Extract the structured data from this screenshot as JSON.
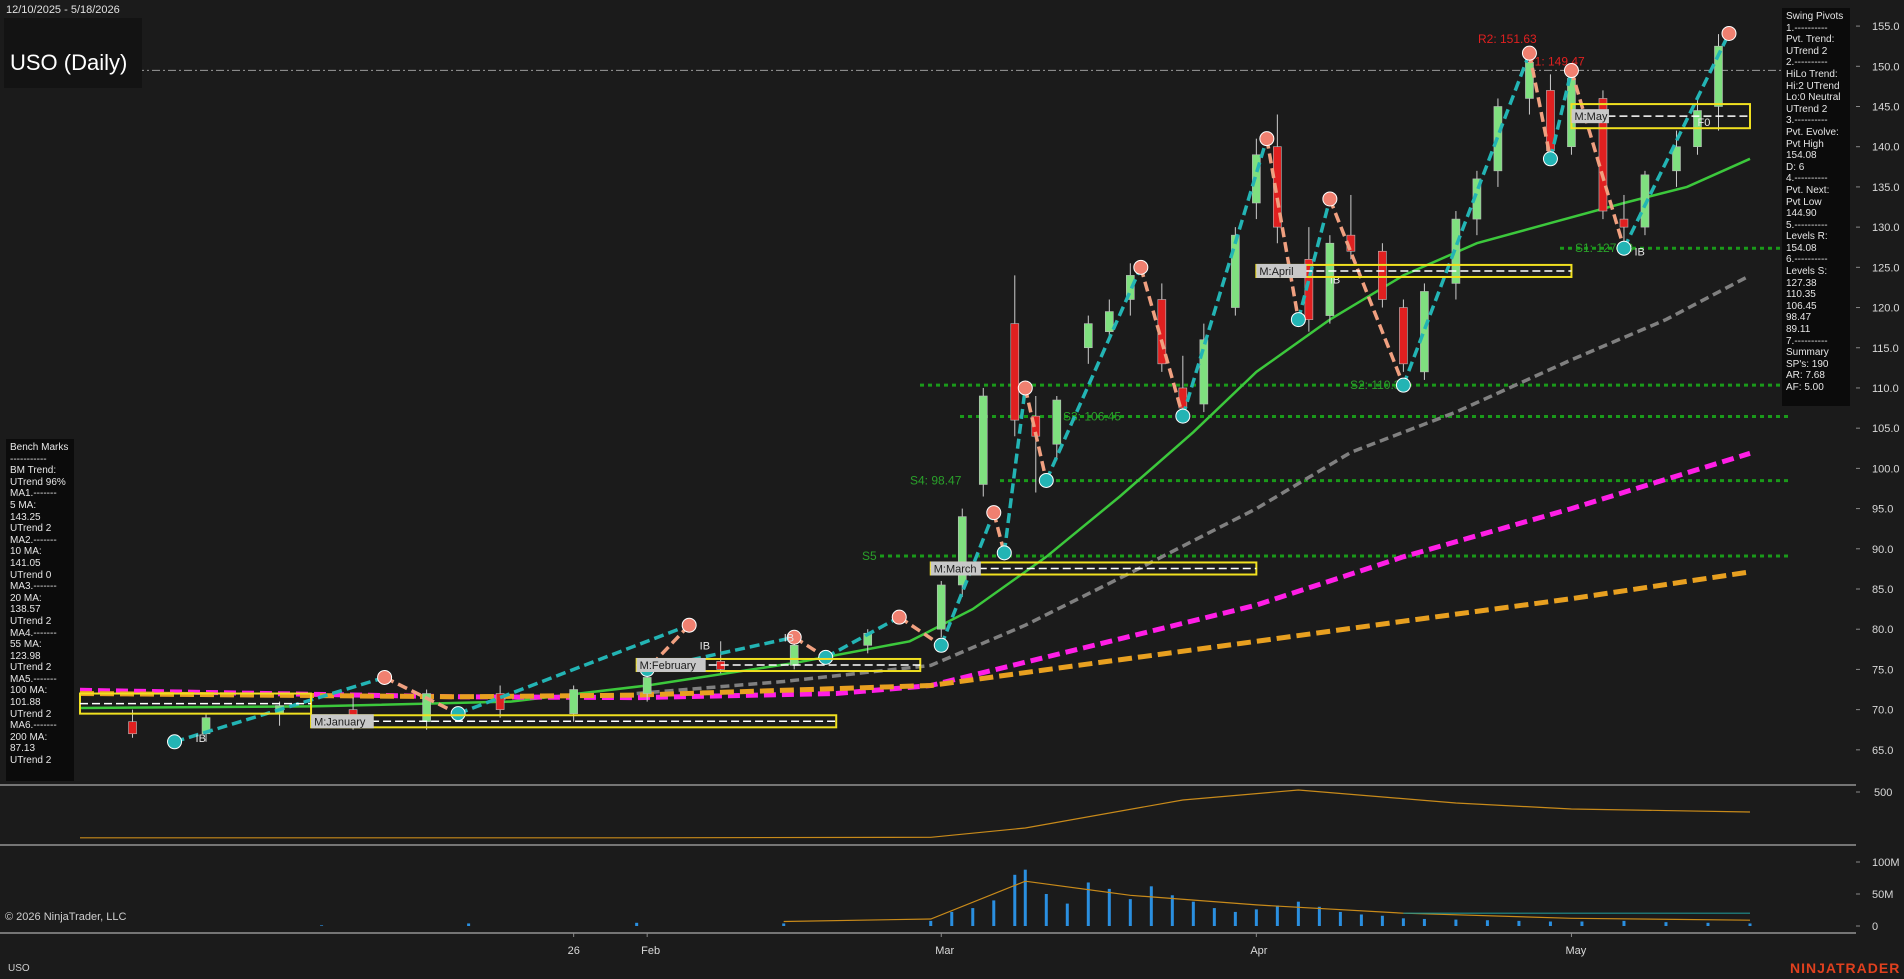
{
  "header": {
    "date_range": "12/10/2025 - 5/18/2026",
    "title": "USO (Daily)"
  },
  "footer": {
    "copyright": "© 2026 NinjaTrader, LLC",
    "symbol": "USO",
    "brand": "NINJATRADER"
  },
  "bench_marks": {
    "lines": [
      "Bench Marks",
      "-----------",
      "BM Trend:",
      "UTrend 96%",
      "MA1.-------",
      "5 MA:",
      "143.25",
      "UTrend 2",
      "MA2.-------",
      "10 MA:",
      "141.05",
      "UTrend 0",
      "MA3.-------",
      "20 MA:",
      "138.57",
      "UTrend 2",
      "MA4.-------",
      "55 MA:",
      "123.98",
      "UTrend 2",
      "MA5.-------",
      "100 MA:",
      "101.88",
      "UTrend 2",
      "MA6.-------",
      "200 MA:",
      "87.13",
      "UTrend 2"
    ]
  },
  "swing_pivots": {
    "lines": [
      "Swing Pivots",
      "1.----------",
      "Pvt. Trend:",
      "UTrend 2",
      "2.----------",
      "HiLo Trend:",
      "Hi:2 UTrend",
      "Lo:0 Neutral",
      "UTrend 2",
      "3.----------",
      "Pvt. Evolve:",
      "Pvt High",
      "154.08",
      "D: 6",
      "4.----------",
      "Pvt. Next:",
      "Pvt Low",
      "144.90",
      "5.----------",
      "Levels R:",
      "154.08",
      "6.----------",
      "Levels S:",
      "127.38",
      "110.35",
      "106.45",
      "98.47",
      "89.11",
      "7.----------",
      "Summary",
      "SP's: 190",
      "AR: 7.68",
      "AF: 5.00"
    ]
  },
  "colors": {
    "background": "#1b1b1b",
    "bull_candle": "#7fe07f",
    "bear_candle": "#e02020",
    "swing_up": "#23b4b4",
    "swing_down": "#f0a080",
    "ma20": "#3cc83c",
    "ma55": "#808080",
    "ma100": "#ff1ee6",
    "ma200": "#e8a020",
    "support": "#1a9a1a",
    "resistance": "#e02020",
    "month_box": "#f0e020"
  },
  "chart_data": [
    {
      "type": "line",
      "title": "USO (Daily)",
      "x_labels": [
        "26",
        "Feb",
        "Mar",
        "Apr",
        "May"
      ],
      "x_label_dates": [
        "2026-01-26",
        "2026-02-02",
        "2026-03-02",
        "2026-04-01",
        "2026-05-01"
      ],
      "x_range": [
        "2025-12-10",
        "2026-05-18"
      ],
      "ylim": [
        61,
        157
      ],
      "y_ticks": [
        65,
        70,
        75,
        80,
        85,
        90,
        95,
        100,
        105,
        110,
        115,
        120,
        125,
        130,
        135,
        140,
        145,
        150,
        155
      ],
      "grid": false,
      "series": [
        {
          "name": "",
          "kind": "ma20",
          "points": [
            [
              "2025-12-10",
              70.2
            ],
            [
              "2026-01-01",
              70.4
            ],
            [
              "2026-01-20",
              71.0
            ],
            [
              "2026-02-02",
              73.0
            ],
            [
              "2026-02-16",
              75.8
            ],
            [
              "2026-02-27",
              78.5
            ],
            [
              "2026-03-05",
              82.5
            ],
            [
              "2026-03-12",
              89.0
            ],
            [
              "2026-03-19",
              96.5
            ],
            [
              "2026-03-26",
              104.5
            ],
            [
              "2026-04-01",
              112.0
            ],
            [
              "2026-04-08",
              118.5
            ],
            [
              "2026-04-15",
              124.0
            ],
            [
              "2026-04-22",
              128.0
            ],
            [
              "2026-04-29",
              130.5
            ],
            [
              "2026-05-06",
              133.0
            ],
            [
              "2026-05-12",
              135.0
            ],
            [
              "2026-05-18",
              138.5
            ]
          ]
        },
        {
          "name": "",
          "kind": "ma55",
          "points": [
            [
              "2026-02-01",
              72.0
            ],
            [
              "2026-02-15",
              73.5
            ],
            [
              "2026-03-01",
              75.5
            ],
            [
              "2026-03-10",
              80.5
            ],
            [
              "2026-03-20",
              87.0
            ],
            [
              "2026-04-01",
              95.0
            ],
            [
              "2026-04-10",
              102.0
            ],
            [
              "2026-04-20",
              107.0
            ],
            [
              "2026-05-01",
              113.5
            ],
            [
              "2026-05-10",
              118.5
            ],
            [
              "2026-05-18",
              123.98
            ]
          ]
        },
        {
          "name": "",
          "kind": "ma100",
          "points": [
            [
              "2025-12-10",
              72.4
            ],
            [
              "2026-01-15",
              71.6
            ],
            [
              "2026-02-01",
              71.5
            ],
            [
              "2026-02-20",
              72.0
            ],
            [
              "2026-03-01",
              73.0
            ],
            [
              "2026-03-15",
              77.5
            ],
            [
              "2026-04-01",
              83.0
            ],
            [
              "2026-04-15",
              89.0
            ],
            [
              "2026-05-01",
              95.0
            ],
            [
              "2026-05-18",
              101.88
            ]
          ]
        },
        {
          "name": "",
          "kind": "ma200",
          "points": [
            [
              "2025-12-10",
              72.0
            ],
            [
              "2026-01-15",
              71.6
            ],
            [
              "2026-02-01",
              71.8
            ],
            [
              "2026-03-01",
              73.0
            ],
            [
              "2026-03-15",
              75.5
            ],
            [
              "2026-04-01",
              78.5
            ],
            [
              "2026-04-15",
              81.0
            ],
            [
              "2026-05-01",
              83.8
            ],
            [
              "2026-05-18",
              87.13
            ]
          ]
        }
      ],
      "candles": [
        {
          "d": "2025-12-15",
          "o": 68.5,
          "h": 70.0,
          "l": 66.5,
          "c": 67.0
        },
        {
          "d": "2025-12-22",
          "o": 67.0,
          "h": 69.5,
          "l": 66.0,
          "c": 69.0
        },
        {
          "d": "2025-12-29",
          "o": 69.5,
          "h": 71.0,
          "l": 68.0,
          "c": 70.5
        },
        {
          "d": "2026-01-05",
          "o": 70.0,
          "h": 71.5,
          "l": 67.5,
          "c": 68.0
        },
        {
          "d": "2026-01-12",
          "o": 68.5,
          "h": 72.5,
          "l": 67.5,
          "c": 72.0
        },
        {
          "d": "2026-01-19",
          "o": 72.0,
          "h": 73.0,
          "l": 69.0,
          "c": 70.0
        },
        {
          "d": "2026-01-26",
          "o": 69.5,
          "h": 73.0,
          "l": 68.5,
          "c": 72.5
        },
        {
          "d": "2026-02-02",
          "o": 72.0,
          "h": 74.5,
          "l": 71.0,
          "c": 74.0
        },
        {
          "d": "2026-02-09",
          "o": 76.0,
          "h": 78.5,
          "l": 74.5,
          "c": 75.0
        },
        {
          "d": "2026-02-16",
          "o": 75.5,
          "h": 78.5,
          "l": 75.0,
          "c": 78.0
        },
        {
          "d": "2026-02-23",
          "o": 78.0,
          "h": 80.0,
          "l": 77.0,
          "c": 79.5
        },
        {
          "d": "2026-03-02",
          "o": 80.0,
          "h": 86.0,
          "l": 79.0,
          "c": 85.5
        },
        {
          "d": "2026-03-04",
          "o": 85.5,
          "h": 95.0,
          "l": 84.0,
          "c": 94.0
        },
        {
          "d": "2026-03-06",
          "o": 98.0,
          "h": 110.0,
          "l": 96.5,
          "c": 109.0
        },
        {
          "d": "2026-03-09",
          "o": 118.0,
          "h": 124.0,
          "l": 104.0,
          "c": 106.0
        },
        {
          "d": "2026-03-11",
          "o": 106.5,
          "h": 109.0,
          "l": 97.0,
          "c": 104.0
        },
        {
          "d": "2026-03-13",
          "o": 103.0,
          "h": 109.0,
          "l": 101.0,
          "c": 108.5
        },
        {
          "d": "2026-03-16",
          "o": 115.0,
          "h": 119.0,
          "l": 113.0,
          "c": 118.0
        },
        {
          "d": "2026-03-18",
          "o": 117.0,
          "h": 121.0,
          "l": 116.0,
          "c": 119.5
        },
        {
          "d": "2026-03-20",
          "o": 121.0,
          "h": 125.5,
          "l": 119.0,
          "c": 124.0
        },
        {
          "d": "2026-03-23",
          "o": 121.0,
          "h": 123.0,
          "l": 112.0,
          "c": 113.0
        },
        {
          "d": "2026-03-25",
          "o": 110.0,
          "h": 114.0,
          "l": 106.0,
          "c": 107.5
        },
        {
          "d": "2026-03-27",
          "o": 108.0,
          "h": 118.0,
          "l": 107.0,
          "c": 116.0
        },
        {
          "d": "2026-03-30",
          "o": 120.0,
          "h": 130.0,
          "l": 119.0,
          "c": 129.0
        },
        {
          "d": "2026-04-01",
          "o": 133.0,
          "h": 141.0,
          "l": 131.0,
          "c": 139.0
        },
        {
          "d": "2026-04-03",
          "o": 140.0,
          "h": 144.0,
          "l": 128.0,
          "c": 130.0
        },
        {
          "d": "2026-04-06",
          "o": 126.0,
          "h": 130.0,
          "l": 117.0,
          "c": 118.5
        },
        {
          "d": "2026-04-08",
          "o": 119.0,
          "h": 129.0,
          "l": 118.0,
          "c": 128.0
        },
        {
          "d": "2026-04-10",
          "o": 129.0,
          "h": 134.0,
          "l": 126.0,
          "c": 127.0
        },
        {
          "d": "2026-04-13",
          "o": 127.0,
          "h": 128.0,
          "l": 120.0,
          "c": 121.0
        },
        {
          "d": "2026-04-15",
          "o": 120.0,
          "h": 121.0,
          "l": 112.0,
          "c": 113.0
        },
        {
          "d": "2026-04-17",
          "o": 112.0,
          "h": 123.0,
          "l": 111.0,
          "c": 122.0
        },
        {
          "d": "2026-04-20",
          "o": 123.0,
          "h": 132.0,
          "l": 121.0,
          "c": 131.0
        },
        {
          "d": "2026-04-22",
          "o": 131.0,
          "h": 137.0,
          "l": 129.0,
          "c": 136.0
        },
        {
          "d": "2026-04-24",
          "o": 137.0,
          "h": 146.0,
          "l": 135.0,
          "c": 145.0
        },
        {
          "d": "2026-04-27",
          "o": 146.0,
          "h": 152.0,
          "l": 144.0,
          "c": 150.5
        },
        {
          "d": "2026-04-29",
          "o": 147.0,
          "h": 149.0,
          "l": 138.0,
          "c": 139.5
        },
        {
          "d": "2026-05-01",
          "o": 140.0,
          "h": 150.0,
          "l": 139.0,
          "c": 148.5
        },
        {
          "d": "2026-05-04",
          "o": 146.0,
          "h": 147.0,
          "l": 131.0,
          "c": 132.0
        },
        {
          "d": "2026-05-06",
          "o": 131.0,
          "h": 134.0,
          "l": 127.0,
          "c": 130.0
        },
        {
          "d": "2026-05-08",
          "o": 130.0,
          "h": 137.0,
          "l": 129.0,
          "c": 136.5
        },
        {
          "d": "2026-05-11",
          "o": 137.0,
          "h": 142.0,
          "l": 135.0,
          "c": 140.0
        },
        {
          "d": "2026-05-13",
          "o": 140.0,
          "h": 146.0,
          "l": 139.0,
          "c": 144.5
        },
        {
          "d": "2026-05-15",
          "o": 145.0,
          "h": 154.0,
          "l": 142.0,
          "c": 152.5
        }
      ],
      "swing_points": [
        [
          "2025-12-19",
          66.0
        ],
        [
          "2026-01-08",
          74.0
        ],
        [
          "2026-01-15",
          69.5
        ],
        [
          "2026-02-06",
          80.5
        ],
        [
          "2026-02-02",
          75.0
        ],
        [
          "2026-02-16",
          79.0
        ],
        [
          "2026-02-19",
          76.5
        ],
        [
          "2026-02-26",
          81.5
        ],
        [
          "2026-03-02",
          78.0
        ],
        [
          "2026-03-07",
          94.5
        ],
        [
          "2026-03-08",
          89.5
        ],
        [
          "2026-03-10",
          110.0
        ],
        [
          "2026-03-12",
          98.5
        ],
        [
          "2026-03-21",
          125.0
        ],
        [
          "2026-03-25",
          106.5
        ],
        [
          "2026-04-02",
          141.0
        ],
        [
          "2026-04-05",
          118.5
        ],
        [
          "2026-04-08",
          133.5
        ],
        [
          "2026-04-15",
          110.35
        ],
        [
          "2026-04-27",
          151.63
        ],
        [
          "2026-04-29",
          138.5
        ],
        [
          "2026-05-01",
          149.47
        ],
        [
          "2026-05-06",
          127.38
        ],
        [
          "2026-05-16",
          154.08
        ]
      ],
      "support_levels": [
        {
          "label": "S1: 127.38",
          "value": 127.38
        },
        {
          "label": "S2: 110.35",
          "value": 110.35
        },
        {
          "label": "S3: 106.45",
          "value": 106.45
        },
        {
          "label": "S4: 98.47",
          "value": 98.47
        },
        {
          "label": "S5",
          "value": 89.11
        }
      ],
      "resistance_levels": [
        {
          "label": "R2: 151.63",
          "value": 151.63
        },
        {
          "label": "R1: 149.47",
          "value": 149.47
        }
      ],
      "reference_line": 149.5,
      "monthly_boxes": [
        {
          "label": "M:January",
          "start": "2026-01-01",
          "end": "2026-02-20",
          "low": 67.8,
          "high": 69.3
        },
        {
          "label": "M:February",
          "start": "2026-02-01",
          "end": "2026-02-28",
          "low": 74.8,
          "high": 76.3
        },
        {
          "label": "M:March",
          "start": "2026-03-01",
          "end": "2026-04-01",
          "low": 86.8,
          "high": 88.3
        },
        {
          "label": "M:April",
          "start": "2026-04-01",
          "end": "2026-05-01",
          "low": 123.8,
          "high": 125.3
        },
        {
          "label": "M:May",
          "start": "2026-05-01",
          "end": "2026-05-18",
          "low": 142.3,
          "high": 145.3
        },
        {
          "label": "",
          "start": "2025-12-10",
          "end": "2026-01-01",
          "low": 69.5,
          "high": 72.0
        }
      ],
      "annotations": [
        "IB",
        "IB",
        "IB",
        "IB",
        "IB",
        "F0"
      ]
    },
    {
      "type": "line",
      "title": "",
      "y_ticks": [
        500
      ],
      "series": [
        {
          "name": "",
          "points": [
            [
              "2025-12-10",
              42
            ],
            [
              "2026-02-01",
              42
            ],
            [
              "2026-03-01",
              47
            ],
            [
              "2026-03-10",
              140
            ],
            [
              "2026-03-25",
              420
            ],
            [
              "2026-04-05",
              520
            ],
            [
              "2026-04-20",
              390
            ],
            [
              "2026-05-01",
              330
            ],
            [
              "2026-05-18",
              300
            ]
          ]
        }
      ]
    },
    {
      "type": "bar",
      "title": "",
      "y_ticks": [
        "0",
        "50M",
        "100M"
      ],
      "volume_millions": [
        [
          "2026-01-02",
          1
        ],
        [
          "2026-01-16",
          4
        ],
        [
          "2026-02-01",
          5
        ],
        [
          "2026-02-15",
          4
        ],
        [
          "2026-03-01",
          8
        ],
        [
          "2026-03-03",
          22
        ],
        [
          "2026-03-05",
          28
        ],
        [
          "2026-03-07",
          40
        ],
        [
          "2026-03-09",
          80
        ],
        [
          "2026-03-10",
          88
        ],
        [
          "2026-03-12",
          50
        ],
        [
          "2026-03-14",
          35
        ],
        [
          "2026-03-16",
          68
        ],
        [
          "2026-03-18",
          58
        ],
        [
          "2026-03-20",
          42
        ],
        [
          "2026-03-22",
          62
        ],
        [
          "2026-03-24",
          48
        ],
        [
          "2026-03-26",
          38
        ],
        [
          "2026-03-28",
          28
        ],
        [
          "2026-03-30",
          22
        ],
        [
          "2026-04-01",
          26
        ],
        [
          "2026-04-03",
          32
        ],
        [
          "2026-04-05",
          38
        ],
        [
          "2026-04-07",
          30
        ],
        [
          "2026-04-09",
          22
        ],
        [
          "2026-04-11",
          18
        ],
        [
          "2026-04-13",
          16
        ],
        [
          "2026-04-15",
          12
        ],
        [
          "2026-04-17",
          11
        ],
        [
          "2026-04-20",
          10
        ],
        [
          "2026-04-23",
          9
        ],
        [
          "2026-04-26",
          8
        ],
        [
          "2026-04-29",
          7
        ],
        [
          "2026-05-02",
          7
        ],
        [
          "2026-05-06",
          8
        ],
        [
          "2026-05-10",
          6
        ],
        [
          "2026-05-14",
          5
        ],
        [
          "2026-05-18",
          4
        ]
      ],
      "volume_avg": [
        [
          "2026-02-15",
          7
        ],
        [
          "2026-03-01",
          11
        ],
        [
          "2026-03-10",
          70
        ],
        [
          "2026-03-20",
          48
        ],
        [
          "2026-04-01",
          33
        ],
        [
          "2026-04-15",
          20
        ],
        [
          "2026-05-01",
          12
        ],
        [
          "2026-05-18",
          9
        ]
      ],
      "ylim": [
        0,
        125
      ]
    }
  ]
}
